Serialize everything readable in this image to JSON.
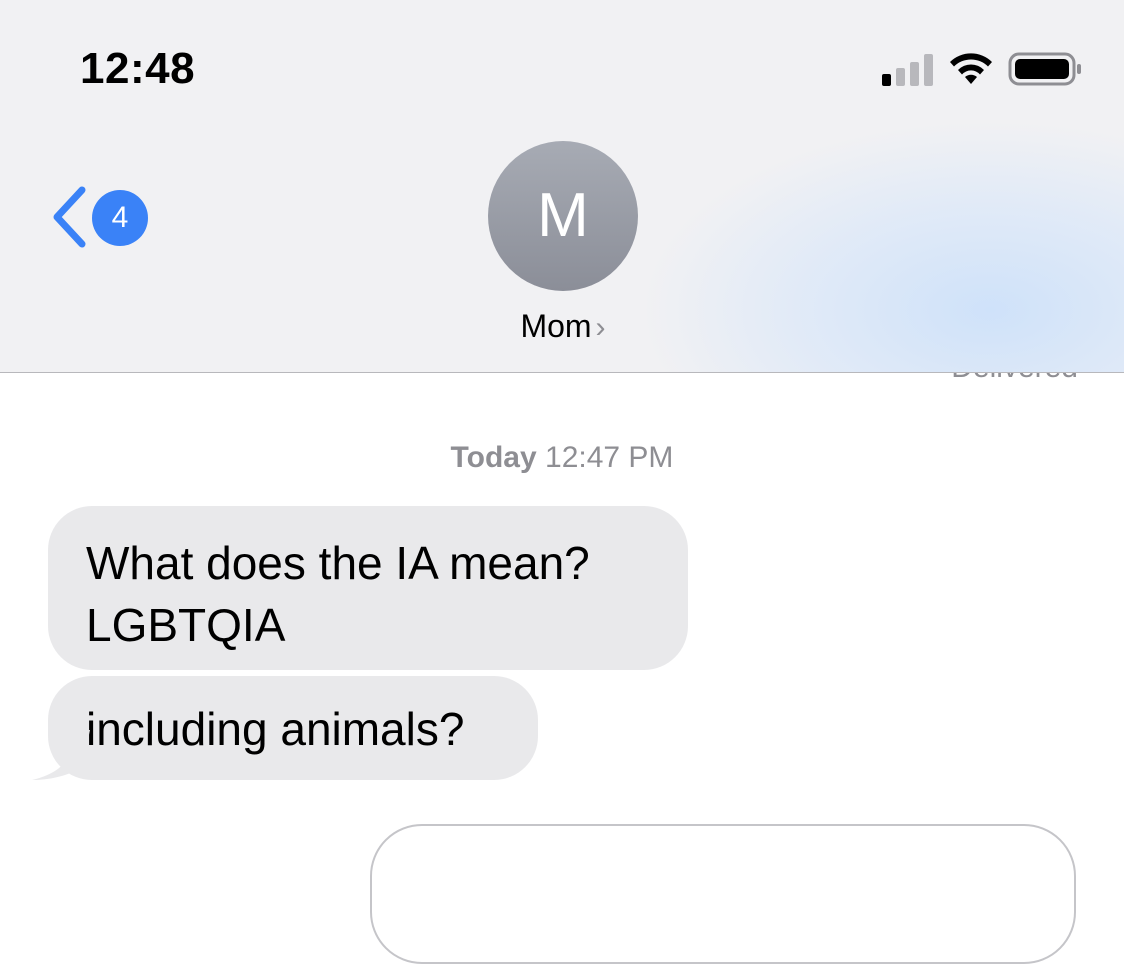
{
  "status_bar": {
    "time": "12:48",
    "signal_bars_active": 1,
    "signal_bars_total": 4,
    "icons": [
      "signal-icon",
      "wifi-icon",
      "battery-icon"
    ]
  },
  "nav": {
    "back_badge": "4",
    "contact_initial": "M",
    "contact_name": "Mom",
    "contact_chevron": "›"
  },
  "thread": {
    "previous_status": "Delivered",
    "timestamp_day": "Today",
    "timestamp_time": "12:47 PM",
    "messages": [
      {
        "sender": "Mom",
        "lines": [
          "What does the IA mean?",
          "LGBTQIA"
        ]
      },
      {
        "sender": "Mom",
        "lines": [
          "including animals?"
        ]
      }
    ]
  },
  "colors": {
    "accent_blue": "#3a82f7",
    "incoming_bubble": "#e9e9eb",
    "secondary_text": "#8e8e93",
    "header_bg": "#f1f1f3"
  }
}
